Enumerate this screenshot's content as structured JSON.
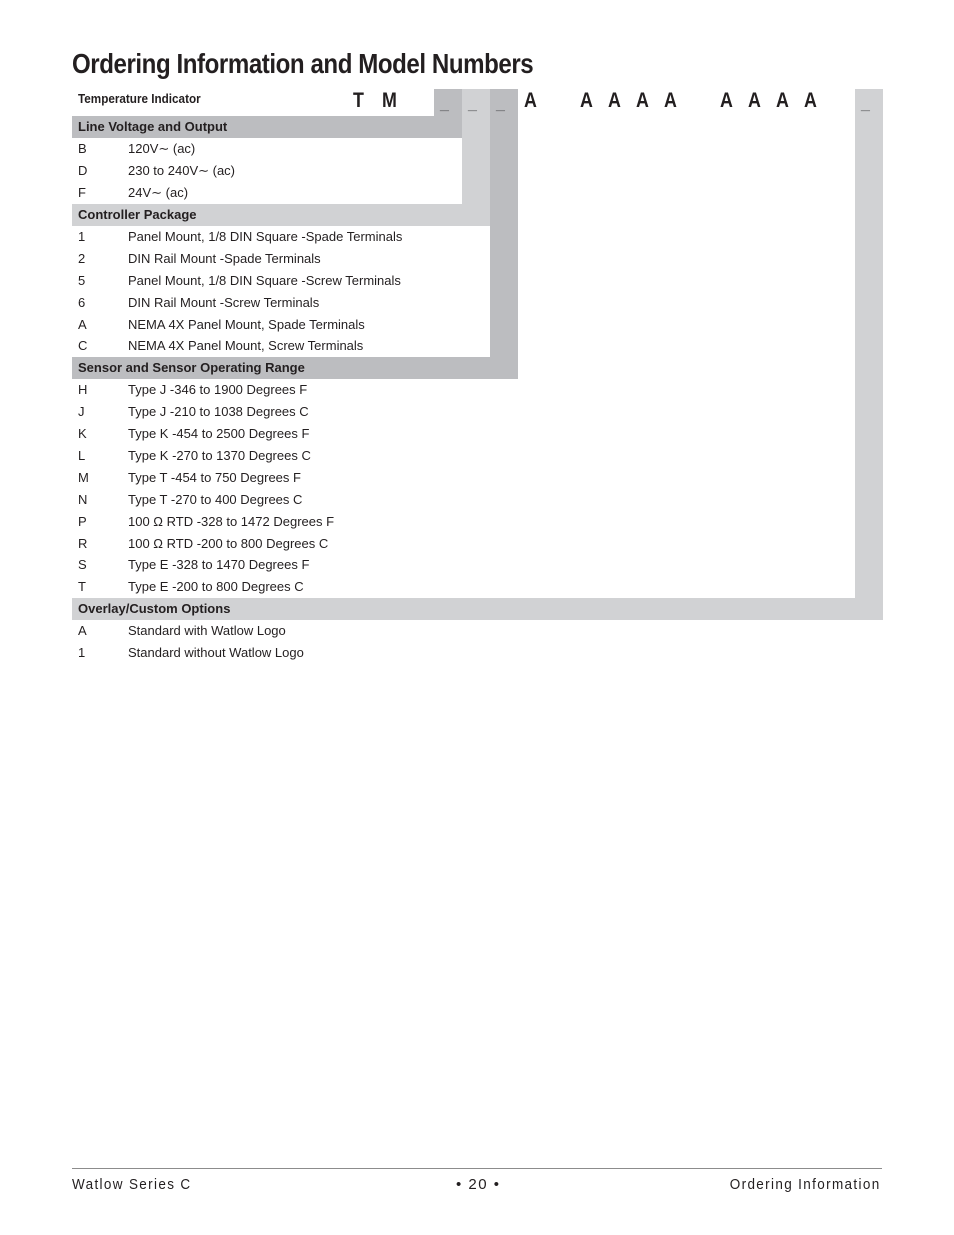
{
  "page_title": "Ordering Information and Model Numbers",
  "product": "Temperature Indicator",
  "model_code": {
    "fixed_prefix": [
      "T",
      "M"
    ],
    "fields": [
      "_",
      "_",
      "_"
    ],
    "fixed_middle": [
      "A",
      "A",
      "A",
      "A",
      "A",
      "A",
      "A",
      "A",
      "A"
    ],
    "last_field": "_"
  },
  "sections": [
    {
      "title": "Line Voltage and Output",
      "options": [
        {
          "code": "B",
          "desc": "120V∼  (ac)"
        },
        {
          "code": "D",
          "desc": "230 to 240V∼  (ac)"
        },
        {
          "code": "F",
          "desc": "24V∼  (ac)"
        }
      ]
    },
    {
      "title": "Controller Package",
      "options": [
        {
          "code": "1",
          "desc": "Panel Mount, 1/8 DIN Square -Spade Terminals"
        },
        {
          "code": "2",
          "desc": "DIN Rail Mount -Spade Terminals"
        },
        {
          "code": "5",
          "desc": "Panel Mount, 1/8 DIN Square -Screw Terminals"
        },
        {
          "code": "6",
          "desc": "DIN Rail Mount -Screw Terminals"
        },
        {
          "code": "A",
          "desc": "NEMA 4X Panel Mount, Spade Terminals"
        },
        {
          "code": "C",
          "desc": "NEMA 4X Panel Mount, Screw Terminals"
        }
      ]
    },
    {
      "title": "Sensor and Sensor Operating Range",
      "options": [
        {
          "code": "H",
          "desc": "Type J  -346 to 1900 Degrees F"
        },
        {
          "code": "J",
          "desc": "Type J -210 to 1038 Degrees C"
        },
        {
          "code": "K",
          "desc": "Type K -454 to 2500 Degrees F"
        },
        {
          "code": "L",
          "desc": "Type K -270 to 1370 Degrees C"
        },
        {
          "code": "M",
          "desc": "Type T -454 to 750 Degrees F"
        },
        {
          "code": "N",
          "desc": "Type T -270 to 400 Degrees C"
        },
        {
          "code": "P",
          "desc": "100 Ω RTD -328 to 1472 Degrees F"
        },
        {
          "code": "R",
          "desc": "100 Ω RTD -200 to 800 Degrees C"
        },
        {
          "code": "S",
          "desc": "Type E -328 to 1470 Degrees F"
        },
        {
          "code": "T",
          "desc": "Type E -200 to 800 Degrees C"
        }
      ]
    },
    {
      "title": "Overlay/Custom Options",
      "options": [
        {
          "code": "A",
          "desc": "Standard with Watlow Logo"
        },
        {
          "code": "1",
          "desc": "Standard without Watlow Logo"
        }
      ]
    }
  ],
  "footer": {
    "left": "Watlow Series C",
    "center": "• 20 •",
    "right": "Ordering Information"
  },
  "colors": {
    "dark_band": "#bcbdc0",
    "light_band": "#d1d2d4",
    "text": "#231f20"
  }
}
